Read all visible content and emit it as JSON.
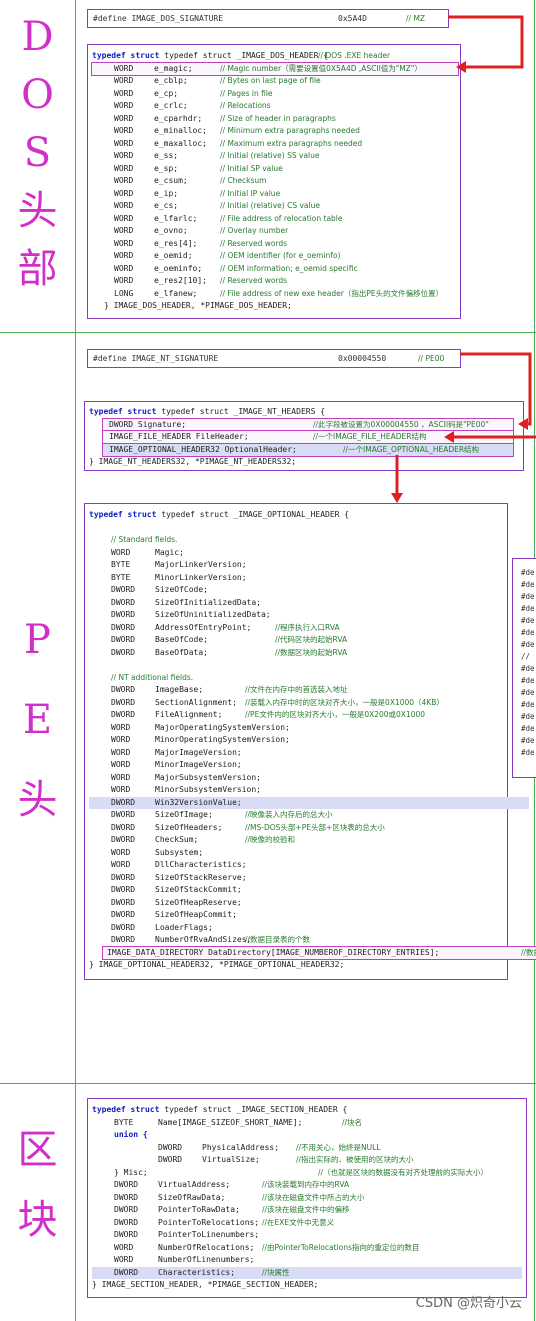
{
  "labels": {
    "dos": [
      "D",
      "O",
      "S",
      "头",
      "部"
    ],
    "pe": [
      "P",
      "E",
      "头"
    ],
    "sec": [
      "区",
      "块"
    ]
  },
  "dos_define": {
    "text": "#define IMAGE_DOS_SIGNATURE",
    "val": "0x5A4D",
    "cmt": "// MZ"
  },
  "dos_header": {
    "open": "typedef struct _IMAGE_DOS_HEADER {",
    "open_cmt": "// DOS .EXE header",
    "rows": [
      {
        "t": "WORD",
        "n": "e_magic;",
        "c": "// Magic number（需要设置值0X5A4D ,ASCII值为\"MZ\"）"
      },
      {
        "t": "WORD",
        "n": "e_cblp;",
        "c": "// Bytes on last page of file"
      },
      {
        "t": "WORD",
        "n": "e_cp;",
        "c": "// Pages in file"
      },
      {
        "t": "WORD",
        "n": "e_crlc;",
        "c": "// Relocations"
      },
      {
        "t": "WORD",
        "n": "e_cparhdr;",
        "c": "// Size of header in paragraphs"
      },
      {
        "t": "WORD",
        "n": "e_minalloc;",
        "c": "// Minimum extra paragraphs needed"
      },
      {
        "t": "WORD",
        "n": "e_maxalloc;",
        "c": "// Maximum extra paragraphs needed"
      },
      {
        "t": "WORD",
        "n": "e_ss;",
        "c": "// Initial (relative) SS value"
      },
      {
        "t": "WORD",
        "n": "e_sp;",
        "c": "// Initial SP value"
      },
      {
        "t": "WORD",
        "n": "e_csum;",
        "c": "// Checksum"
      },
      {
        "t": "WORD",
        "n": "e_ip;",
        "c": "// Initial IP value"
      },
      {
        "t": "WORD",
        "n": "e_cs;",
        "c": "// Initial (relative) CS value"
      },
      {
        "t": "WORD",
        "n": "e_lfarlc;",
        "c": "// File address of relocation table"
      },
      {
        "t": "WORD",
        "n": "e_ovno;",
        "c": "// Overlay number"
      },
      {
        "t": "WORD",
        "n": "e_res[4];",
        "c": "// Reserved words"
      },
      {
        "t": "WORD",
        "n": "e_oemid;",
        "c": "// OEM identifier (for e_oeminfo)"
      },
      {
        "t": "WORD",
        "n": "e_oeminfo;",
        "c": "// OEM information; e_oemid specific"
      },
      {
        "t": "WORD",
        "n": "e_res2[10];",
        "c": "// Reserved words"
      },
      {
        "t": "LONG",
        "n": "e_lfanew;",
        "c": "// File address of new exe header（指出PE头的文件偏移位置）"
      }
    ],
    "close": "} IMAGE_DOS_HEADER, *PIMAGE_DOS_HEADER;"
  },
  "nt_define": {
    "text": "#define IMAGE_NT_SIGNATURE",
    "val": "0x00004550",
    "cmt": "// PE00"
  },
  "nt_header": {
    "open": "typedef struct _IMAGE_NT_HEADERS {",
    "rows": [
      {
        "t": "DWORD Signature;",
        "c": "//此字段被设置为0X00004550 ，ASCII码是\"PE00\""
      },
      {
        "t": "IMAGE_FILE_HEADER FileHeader;",
        "c": "//一个IMAGE_FILE_HEADER结构"
      },
      {
        "t": "IMAGE_OPTIONAL_HEADER32 OptionalHeader;",
        "c": "//一个IMAGE_OPTIONAL_HEADER结构"
      }
    ],
    "close": "} IMAGE_NT_HEADERS32, *PIMAGE_NT_HEADERS32;"
  },
  "opt_header": {
    "open": "typedef struct _IMAGE_OPTIONAL_HEADER {",
    "std_cmt": "// Standard fields.",
    "std": [
      {
        "t": "WORD",
        "n": "Magic;",
        "c": ""
      },
      {
        "t": "BYTE",
        "n": "MajorLinkerVersion;",
        "c": ""
      },
      {
        "t": "BYTE",
        "n": "MinorLinkerVersion;",
        "c": ""
      },
      {
        "t": "DWORD",
        "n": "SizeOfCode;",
        "c": ""
      },
      {
        "t": "DWORD",
        "n": "SizeOfInitializedData;",
        "c": ""
      },
      {
        "t": "DWORD",
        "n": "SizeOfUninitializedData;",
        "c": ""
      },
      {
        "t": "DWORD",
        "n": "AddressOfEntryPoint;",
        "c": "//程序执行入口RVA"
      },
      {
        "t": "DWORD",
        "n": "BaseOfCode;",
        "c": "//代码区块的起始RVA"
      },
      {
        "t": "DWORD",
        "n": "BaseOfData;",
        "c": "//数据区块的起始RVA"
      }
    ],
    "nt_cmt": "// NT additional fields.",
    "nt": [
      {
        "t": "DWORD",
        "n": "ImageBase;",
        "c": "//文件在内存中的首选装入地址"
      },
      {
        "t": "DWORD",
        "n": "SectionAlignment;",
        "c": "//装载入内存中时的区块对齐大小，一般是0X1000（4KB）"
      },
      {
        "t": "DWORD",
        "n": "FileAlignment;",
        "c": "//PE文件内的区块对齐大小，一般是0X200或0X1000"
      },
      {
        "t": "WORD",
        "n": "MajorOperatingSystemVersion;",
        "c": ""
      },
      {
        "t": "WORD",
        "n": "MinorOperatingSystemVersion;",
        "c": ""
      },
      {
        "t": "WORD",
        "n": "MajorImageVersion;",
        "c": ""
      },
      {
        "t": "WORD",
        "n": "MinorImageVersion;",
        "c": ""
      },
      {
        "t": "WORD",
        "n": "MajorSubsystemVersion;",
        "c": ""
      },
      {
        "t": "WORD",
        "n": "MinorSubsystemVersion;",
        "c": ""
      },
      {
        "t": "DWORD",
        "n": "Win32VersionValue;",
        "c": ""
      },
      {
        "t": "DWORD",
        "n": "SizeOfImage;",
        "c": "//映像装入内存后的总大小"
      },
      {
        "t": "DWORD",
        "n": "SizeOfHeaders;",
        "c": "//MS-DOS头部+PE头部+区块表的总大小"
      },
      {
        "t": "DWORD",
        "n": "CheckSum;",
        "c": "//映像的校验和"
      },
      {
        "t": "WORD",
        "n": "Subsystem;",
        "c": ""
      },
      {
        "t": "WORD",
        "n": "DllCharacteristics;",
        "c": ""
      },
      {
        "t": "DWORD",
        "n": "SizeOfStackReserve;",
        "c": ""
      },
      {
        "t": "DWORD",
        "n": "SizeOfStackCommit;",
        "c": ""
      },
      {
        "t": "DWORD",
        "n": "SizeOfHeapReserve;",
        "c": ""
      },
      {
        "t": "DWORD",
        "n": "SizeOfHeapCommit;",
        "c": ""
      },
      {
        "t": "DWORD",
        "n": "LoaderFlags;",
        "c": ""
      },
      {
        "t": "DWORD",
        "n": "NumberOfRvaAndSizes;",
        "c": "//数据目录表的个数"
      }
    ],
    "dd": "IMAGE_DATA_DIRECTORY DataDirectory[IMAGE_NUMBEROF_DIRECTORY_ENTRIES];",
    "dd_cmt": "//数据",
    "close": "} IMAGE_OPTIONAL_HEADER32, *PIMAGE_OPTIONAL_HEADER32;"
  },
  "side_rows": [
    "#de",
    "#de",
    "#de",
    "#de",
    "#de",
    "#de",
    "#de",
    "//",
    "#de",
    "#de",
    "#de",
    "#de",
    "#de",
    "#de",
    "#de",
    "#de"
  ],
  "sec_header": {
    "open": "typedef struct _IMAGE_SECTION_HEADER {",
    "name_t": "BYTE",
    "name_n": "Name[IMAGE_SIZEOF_SHORT_NAME];",
    "name_c": "//块名",
    "union": "union {",
    "phys_t": "DWORD",
    "phys_n": "PhysicalAddress;",
    "phys_c": "//不用关心，始终是NULL",
    "vs_t": "DWORD",
    "vs_n": "VirtualSize;",
    "vs_c": "//指出实际的、被使用的区块的大小",
    "misc": "} Misc;",
    "misc_c": "//（也就是区块的数据没有对齐处理前的实际大小）",
    "rows": [
      {
        "t": "DWORD",
        "n": "VirtualAddress;",
        "c": "//该块装载到内存中的RVA"
      },
      {
        "t": "DWORD",
        "n": "SizeOfRawData;",
        "c": "//该块在磁盘文件中所占的大小"
      },
      {
        "t": "DWORD",
        "n": "PointerToRawData;",
        "c": "//该块在磁盘文件中的偏移"
      },
      {
        "t": "DWORD",
        "n": "PointerToRelocations;",
        "c": "//在EXE文件中无意义"
      },
      {
        "t": "DWORD",
        "n": "PointerToLinenumbers;",
        "c": ""
      },
      {
        "t": "WORD",
        "n": "NumberOfRelocations;",
        "c": "//由PointerToRelocations指向的重定位的数目"
      },
      {
        "t": "WORD",
        "n": "NumberOfLinenumbers;",
        "c": ""
      },
      {
        "t": "DWORD",
        "n": "Characteristics;",
        "c": "//块属性"
      }
    ],
    "close": "} IMAGE_SECTION_HEADER, *PIMAGE_SECTION_HEADER;"
  },
  "watermark": "CSDN @炽奇小云",
  "colors": {
    "arrow": "#e02020",
    "label": "#d030c8",
    "border": "#8a3cc0",
    "grid": "#4caf50"
  }
}
